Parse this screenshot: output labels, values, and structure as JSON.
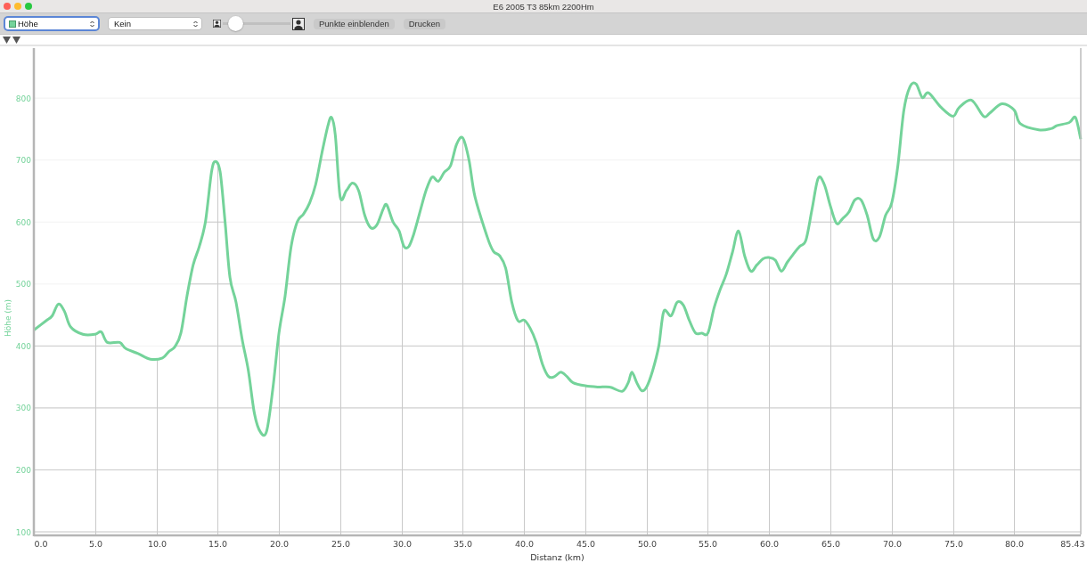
{
  "window": {
    "title": "E6 2005 T3 85km 2200Hm"
  },
  "toolbar": {
    "series_popup": {
      "focused": true
    },
    "smoothing_popup": {
      "value": "Kein",
      "focused": false
    },
    "zoom_slider": {
      "level": 0.1
    },
    "buttons": [
      "Punkte einblenden",
      "Drucken"
    ]
  },
  "chart": {
    "chart_data": {
      "type": "line",
      "grid": true,
      "xlabel": "Distanz (km)",
      "ylabel": "Höhe (m)",
      "xlim": [
        0,
        85.43
      ],
      "ylim": [
        95,
        880
      ],
      "xticks": [
        {
          "value": 0,
          "label": "0.0"
        },
        {
          "value": 5,
          "label": "5.0"
        },
        {
          "value": 10,
          "label": "10.0"
        },
        {
          "value": 15,
          "label": "15.0"
        },
        {
          "value": 20,
          "label": "20.0"
        },
        {
          "value": 25,
          "label": "25.0"
        },
        {
          "value": 30,
          "label": "30.0"
        },
        {
          "value": 35,
          "label": "35.0"
        },
        {
          "value": 40,
          "label": "40.0"
        },
        {
          "value": 45,
          "label": "45.0"
        },
        {
          "value": 50,
          "label": "50.0"
        },
        {
          "value": 55,
          "label": "55.0"
        },
        {
          "value": 60,
          "label": "60.0"
        },
        {
          "value": 65,
          "label": "65.0"
        },
        {
          "value": 70,
          "label": "70.0"
        },
        {
          "value": 75,
          "label": "75.0"
        },
        {
          "value": 80,
          "label": "80.0"
        },
        {
          "value": 85.43,
          "label": "85.43"
        }
      ],
      "yticks": [
        100,
        200,
        300,
        400,
        500,
        600,
        700,
        800
      ],
      "x": [
        0,
        1,
        1.5,
        2,
        2.5,
        3,
        4,
        5,
        5.5,
        6,
        7,
        7.5,
        8.5,
        9.5,
        10.5,
        11,
        11.5,
        12,
        12.5,
        13,
        13.5,
        14,
        14.5,
        14.8,
        15.2,
        15.6,
        16,
        16.5,
        17,
        17.5,
        18,
        18.5,
        19,
        19.5,
        20,
        20.5,
        21,
        21.5,
        22,
        22.5,
        23,
        23.5,
        24,
        24.3,
        24.6,
        25,
        25.5,
        26,
        26.5,
        27,
        27.5,
        28,
        28.5,
        28.8,
        29.3,
        29.8,
        30.2,
        30.6,
        31,
        31.5,
        32,
        32.5,
        33,
        33.5,
        34,
        34.5,
        35,
        35.5,
        36,
        37,
        37.5,
        38,
        38.5,
        39,
        39.5,
        40,
        40.5,
        41,
        41.5,
        42,
        42.5,
        43,
        43.5,
        44,
        45,
        46,
        47,
        48,
        48.5,
        48.8,
        49.2,
        49.6,
        50,
        50.5,
        51,
        51.4,
        52,
        52.5,
        53,
        53.5,
        54,
        54.5,
        55,
        55.5,
        56,
        56.5,
        57,
        57.5,
        58,
        58.5,
        59,
        59.5,
        60,
        60.5,
        61,
        61.5,
        62,
        62.5,
        63,
        63.5,
        64,
        64.5,
        65,
        65.5,
        66,
        66.5,
        67,
        67.5,
        68,
        68.5,
        69,
        69.5,
        70,
        70.5,
        71,
        71.5,
        72,
        72.5,
        73,
        74,
        75,
        75.5,
        76.5,
        77.5,
        78,
        79,
        80,
        80.5,
        82,
        83,
        83.5,
        84.5,
        85,
        85.43
      ],
      "series": [
        {
          "name": "Höhe",
          "color": "#74d39a",
          "values": [
            425,
            440,
            448,
            467,
            455,
            430,
            418,
            418,
            422,
            405,
            405,
            395,
            387,
            378,
            380,
            390,
            398,
            420,
            480,
            530,
            560,
            600,
            680,
            697,
            680,
            600,
            510,
            470,
            410,
            360,
            290,
            260,
            262,
            330,
            420,
            480,
            560,
            600,
            612,
            630,
            660,
            710,
            755,
            768,
            740,
            640,
            650,
            662,
            650,
            610,
            590,
            595,
            620,
            627,
            600,
            585,
            560,
            560,
            580,
            615,
            650,
            672,
            665,
            680,
            690,
            725,
            735,
            700,
            640,
            575,
            552,
            545,
            525,
            470,
            440,
            441,
            428,
            405,
            370,
            350,
            350,
            357,
            350,
            340,
            335,
            333,
            333,
            326,
            340,
            357,
            340,
            327,
            333,
            360,
            400,
            455,
            448,
            470,
            465,
            440,
            420,
            420,
            420,
            460,
            490,
            515,
            550,
            585,
            545,
            520,
            530,
            540,
            542,
            538,
            520,
            535,
            548,
            560,
            570,
            620,
            670,
            660,
            625,
            597,
            605,
            615,
            635,
            635,
            610,
            572,
            575,
            610,
            630,
            690,
            780,
            818,
            822,
            800,
            808,
            785,
            770,
            784,
            796,
            770,
            775,
            790,
            780,
            758,
            748,
            750,
            755,
            760,
            768,
            733
          ]
        }
      ]
    }
  }
}
